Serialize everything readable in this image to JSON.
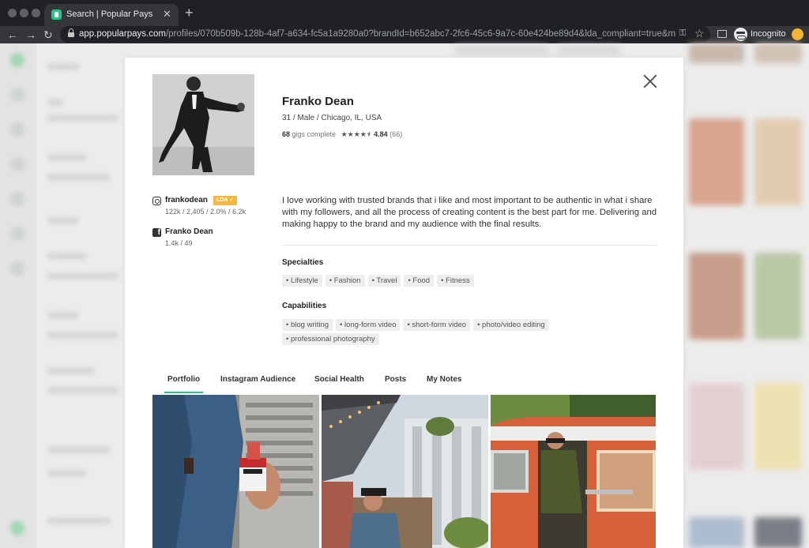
{
  "browser": {
    "tab_title": "Search | Popular Pays",
    "tab_close": "✕",
    "new_tab": "+",
    "url_domain": "app.popularpays.com",
    "url_path": "/profiles/070b509b-128b-4af7-a634-fc5a1a9280a0?brandId=b652abc7-2fc6-45c6-9a7c-60e424be89d4&lda_compliant=true&min_follower_c...",
    "incognito_label": "Incognito",
    "back": "←",
    "forward": "→",
    "reload": "↻",
    "key_icon": "⚿",
    "star_icon": "☆"
  },
  "profile": {
    "name": "Franko Dean",
    "demographics": "31 / Male / Chicago, IL, USA",
    "gigs_count": "68",
    "gigs_label": "gigs complete",
    "stars": "★★★★⯨",
    "rating": "4.84",
    "rating_count": "(66)",
    "bio": "I love working with trusted brands that i like and most important to be authentic in what i share with my followers, and all the process of creating content is the best part for me. Delivering and making happy to the brand and my audience with the final results."
  },
  "social": {
    "instagram": {
      "handle": "frankodean",
      "badge": "LDA ✓",
      "stats": "122k / 2,405 / 2.0% / 6.2k"
    },
    "facebook": {
      "glyph": "f",
      "name": "Franko Dean",
      "stats": "1.4k / 49"
    }
  },
  "specialties": {
    "title": "Specialties",
    "items": [
      "• Lifestyle",
      "• Fashion",
      "• Travel",
      "• Food",
      "• Fitness"
    ]
  },
  "capabilities": {
    "title": "Capabilities",
    "items": [
      "• blog writing",
      "• long-form video",
      "• short-form video",
      "• photo/video editing",
      "• professional photography"
    ]
  },
  "tabs": [
    "Portfolio",
    "Instagram Audience",
    "Social Health",
    "Posts",
    "My Notes"
  ],
  "active_tab": "Portfolio",
  "colors": {
    "accent": "#2fbf8b",
    "badge": "#f6b73c"
  },
  "icons": {
    "close": "close-icon",
    "instagram": "instagram-icon",
    "facebook": "facebook-icon",
    "lock": "lock-icon"
  }
}
